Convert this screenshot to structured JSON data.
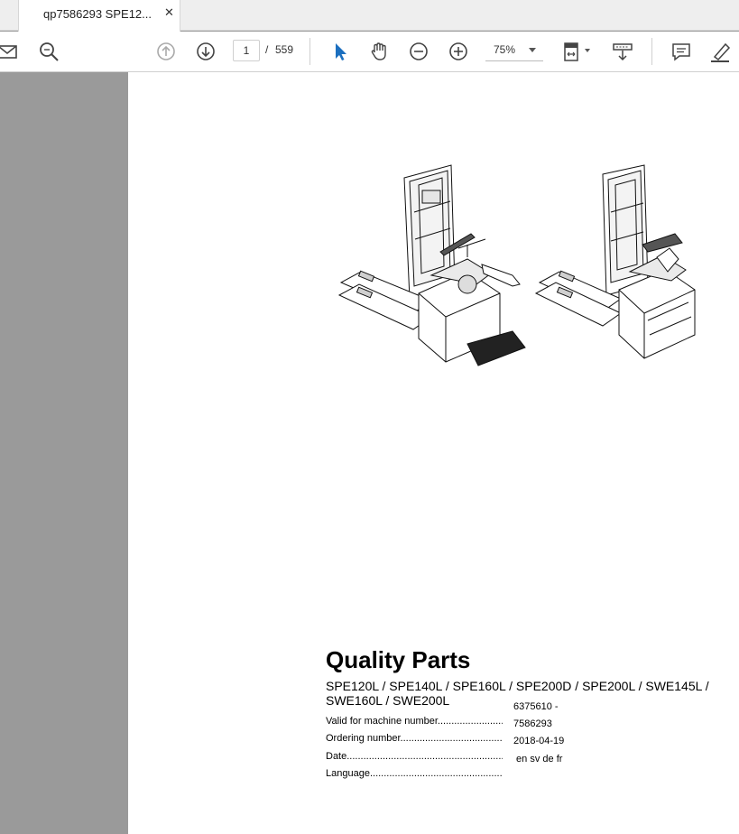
{
  "tab": {
    "title": "qp7586293 SPE12...",
    "close": "✕"
  },
  "toolbar": {
    "icons": [
      "mail-icon",
      "zoom-search-icon",
      "page-up-icon",
      "page-down-icon",
      "select-cursor-icon",
      "hand-tool-icon",
      "zoom-out-icon",
      "zoom-in-icon",
      "page-fit-icon",
      "scroll-mode-icon",
      "comment-icon",
      "highlight-pen-icon"
    ],
    "page_current": "1",
    "page_separator": "/",
    "page_total": "559",
    "zoom": "75%",
    "accent": "#1c6fbf"
  },
  "document": {
    "title": "Quality Parts",
    "models": "SPE120L / SPE140L / SPE160L / SPE200D / SPE200L / SWE145L / SWE160L / SWE200L",
    "rows": [
      {
        "label": "Valid for machine number",
        "dots": "......................................",
        "value": "6375610 -"
      },
      {
        "label": "",
        "dots": "",
        "value": "7586293"
      },
      {
        "label": "Ordering number",
        "dots": "..................................................",
        "value": "2018-04-19"
      },
      {
        "label": "Date",
        "dots": "...................................................................................",
        "value": " en sv de fr"
      },
      {
        "label": "Language",
        "dots": "...........................................................................",
        "value": ""
      }
    ]
  }
}
